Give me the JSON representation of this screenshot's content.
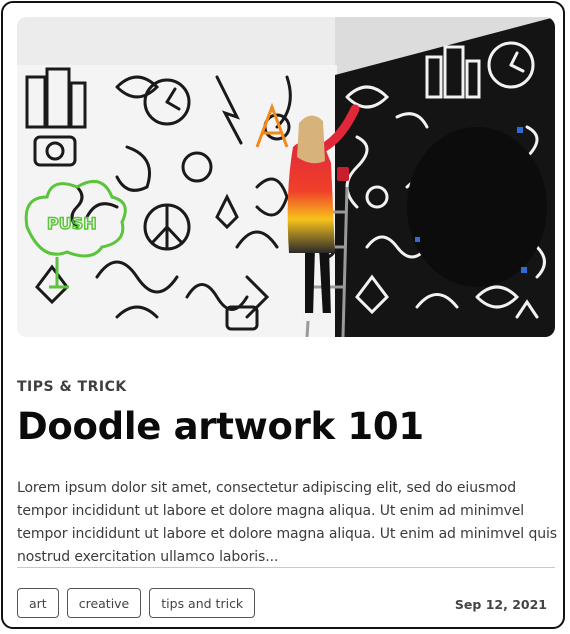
{
  "hero": {
    "alt": "Artist painting a black and white doodle mural on a wall"
  },
  "post": {
    "category": "TIPS & TRICK",
    "title": "Doodle artwork 101",
    "excerpt": "Lorem ipsum dolor sit amet, consectetur adipiscing elit, sed do eiusmod tempor incididunt ut labore et dolore magna aliqua. Ut enim ad minimvel tempor incididunt ut labore et dolore magna aliqua. Ut enim ad minimvel quis nostrud exercitation ullamco laboris..."
  },
  "tags": [
    {
      "label": "art"
    },
    {
      "label": "creative"
    },
    {
      "label": "tips and trick"
    }
  ],
  "date": "Sep 12, 2021"
}
